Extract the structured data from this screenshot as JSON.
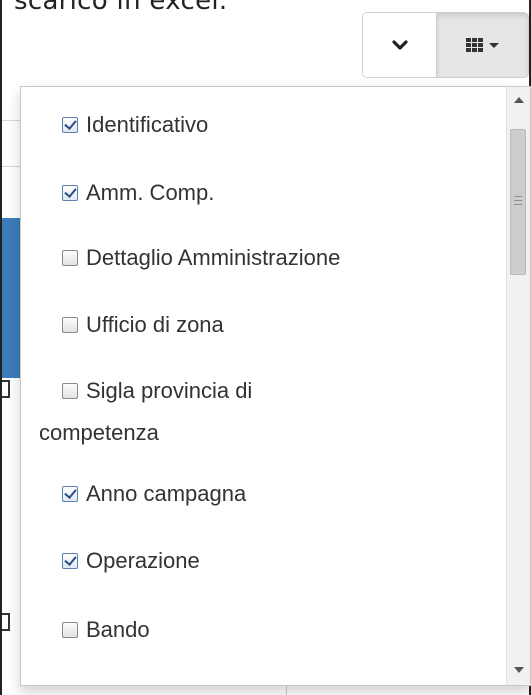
{
  "page": {
    "top_text": "scarico in excel."
  },
  "toolbar": {
    "toggle_button": {
      "icon": "chevron-down-icon"
    },
    "columns_button": {
      "icon": "grid-icon",
      "caret": "caret-down-icon"
    }
  },
  "columns_menu": {
    "items": [
      {
        "label": "Identificativo",
        "checked": true
      },
      {
        "label": "Amm. Comp.",
        "checked": true
      },
      {
        "label": "Dettaglio Amministrazione",
        "checked": false
      },
      {
        "label": "Ufficio di zona",
        "checked": false
      },
      {
        "label_line1": "Sigla provincia di",
        "label_line2": "competenza",
        "checked": false
      },
      {
        "label": "Anno campagna",
        "checked": true
      },
      {
        "label": "Operazione",
        "checked": true
      },
      {
        "label": "Bando",
        "checked": false
      }
    ]
  },
  "colors": {
    "accent": "#3c7cb8",
    "checkbox_check": "#2b4f86"
  }
}
